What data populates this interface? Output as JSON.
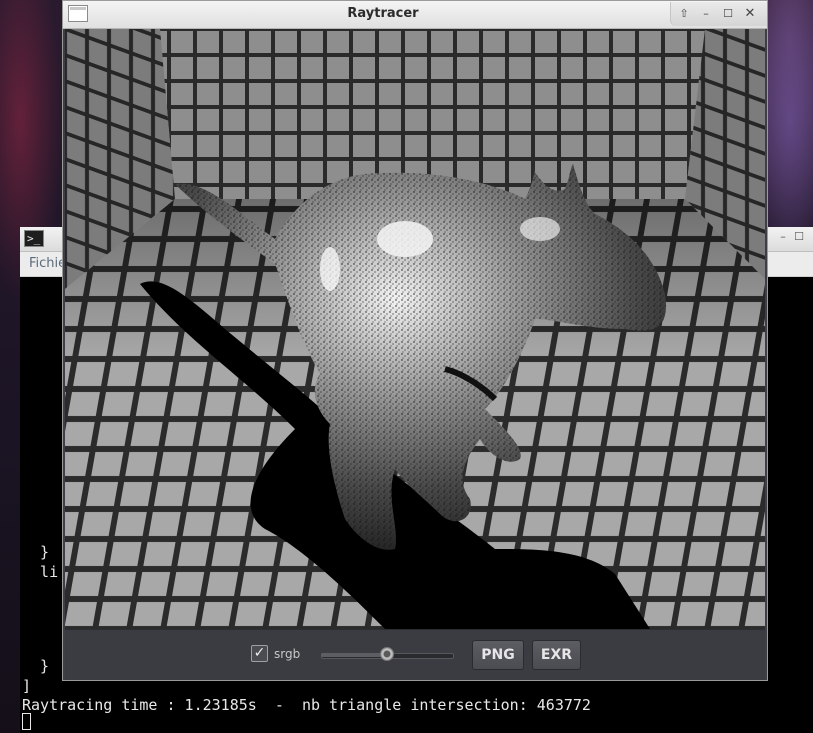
{
  "terminal": {
    "menu": [
      "Fichie"
    ],
    "lines": [
      "  }",
      "  li",
      "  }",
      "]",
      "Raytracing time : 1.23185s  -  nb triangle intersection: 463772"
    ]
  },
  "raytracer": {
    "title": "Raytracer",
    "window_controls": [
      "up-arrow-icon",
      "minimize-icon",
      "maximize-icon",
      "close-icon"
    ],
    "render": {
      "scene": "metallic kangaroo model in tiled box",
      "icon": "rendered-image"
    },
    "toolbar": {
      "srgb_checked": true,
      "srgb_label": "srgb",
      "slider_value": 0.5,
      "png_label": "PNG",
      "exr_label": "EXR"
    }
  },
  "colors": {
    "toolbar_bg": "#3a3c41",
    "terminal_bg": "#000000",
    "terminal_fg": "#e8e8e8",
    "tile_light": "#9a9a9a",
    "grout": "#2e2e2e"
  }
}
